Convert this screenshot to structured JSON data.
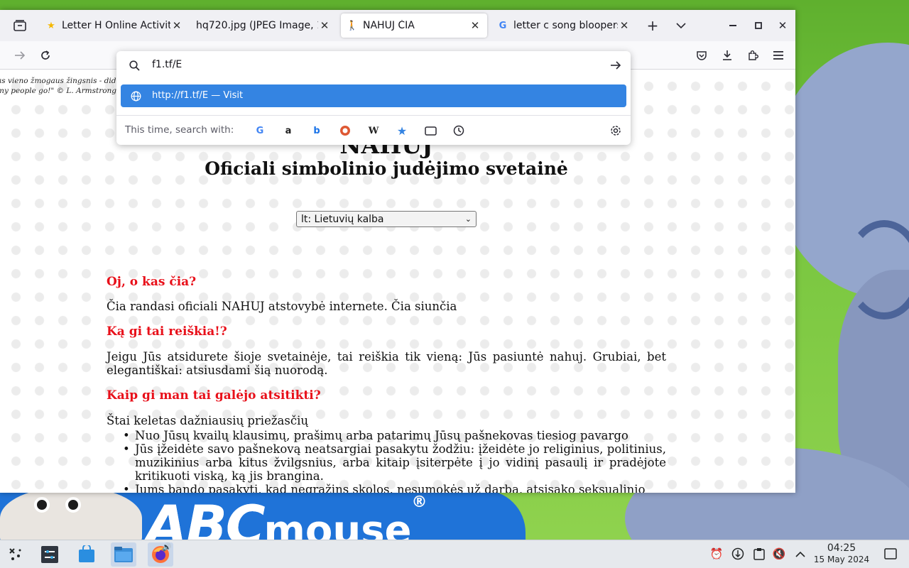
{
  "tabs": [
    {
      "title": "Letter H Online Activiti",
      "icon": "star-favicon"
    },
    {
      "title": "hq720.jpg (JPEG Image, 12",
      "icon": "none"
    },
    {
      "title": "NAHUJ ČIA",
      "icon": "walker-favicon"
    },
    {
      "title": "letter c song bloopers",
      "icon": "google-favicon"
    }
  ],
  "urlbar": {
    "value": "f1.tf/E",
    "suggestion_url": "http://f1.tf/E",
    "suggestion_action": "— Visit",
    "search_with_label": "This time, search with:"
  },
  "page": {
    "quote": "as vieno žmogaus žingsnis - dide\nmy people go!\" © L. Armstrong",
    "title": "NAHUJ",
    "subtitle": "Oficiali simbolinio judėjimo svetainė",
    "language_selected": "lt: Lietuvių kalba",
    "h1": "Oj, o kas čia?",
    "p1": "Čia randasi oficiali NAHUJ atstovybė internete. Čia siunčia",
    "h2": "Ką gi tai reiškia!?",
    "p2": "Jeigu Jūs atsidurete šioje svetainėje, tai reiškia tik vieną: Jūs pasiuntė nahuj. Grubiai, bet elegantiškai: atsiusdami šią nuorodą.",
    "h3": "Kaip gi man tai galėjo atsitikti?",
    "p3": "Štai keletas dažniausių priežasčių",
    "reasons": [
      "Nuo Jūsų kvailų klausimų, prašimų arba patarimų Jūsų pašnekovas tiesiog pavargo",
      "Jūs įžeidėte savo pašnekovą neatsargiai pasakytu žodžiu: įžeidėte jo religinius, politinius, muzikinius arba kitus žvilgsnius, arba kitaip įsiterpėte į jo vidinį pasaulį ir pradėjote kritikuoti viską, ką jis brangina.",
      "Jums bando pasakyti, kad negrąžins skolos, nesumokės už darbą, atsisako seksualinio"
    ]
  },
  "wallpaper": {
    "logo_abc": "ABC",
    "logo_mouse": "mouse",
    "logo_reg": "®"
  },
  "taskbar": {
    "time": "04:25",
    "date": "15 May 2024"
  },
  "colors": {
    "accent": "#3484e2",
    "heading_red": "#e8101a",
    "taskbar": "#e6e9ed"
  }
}
